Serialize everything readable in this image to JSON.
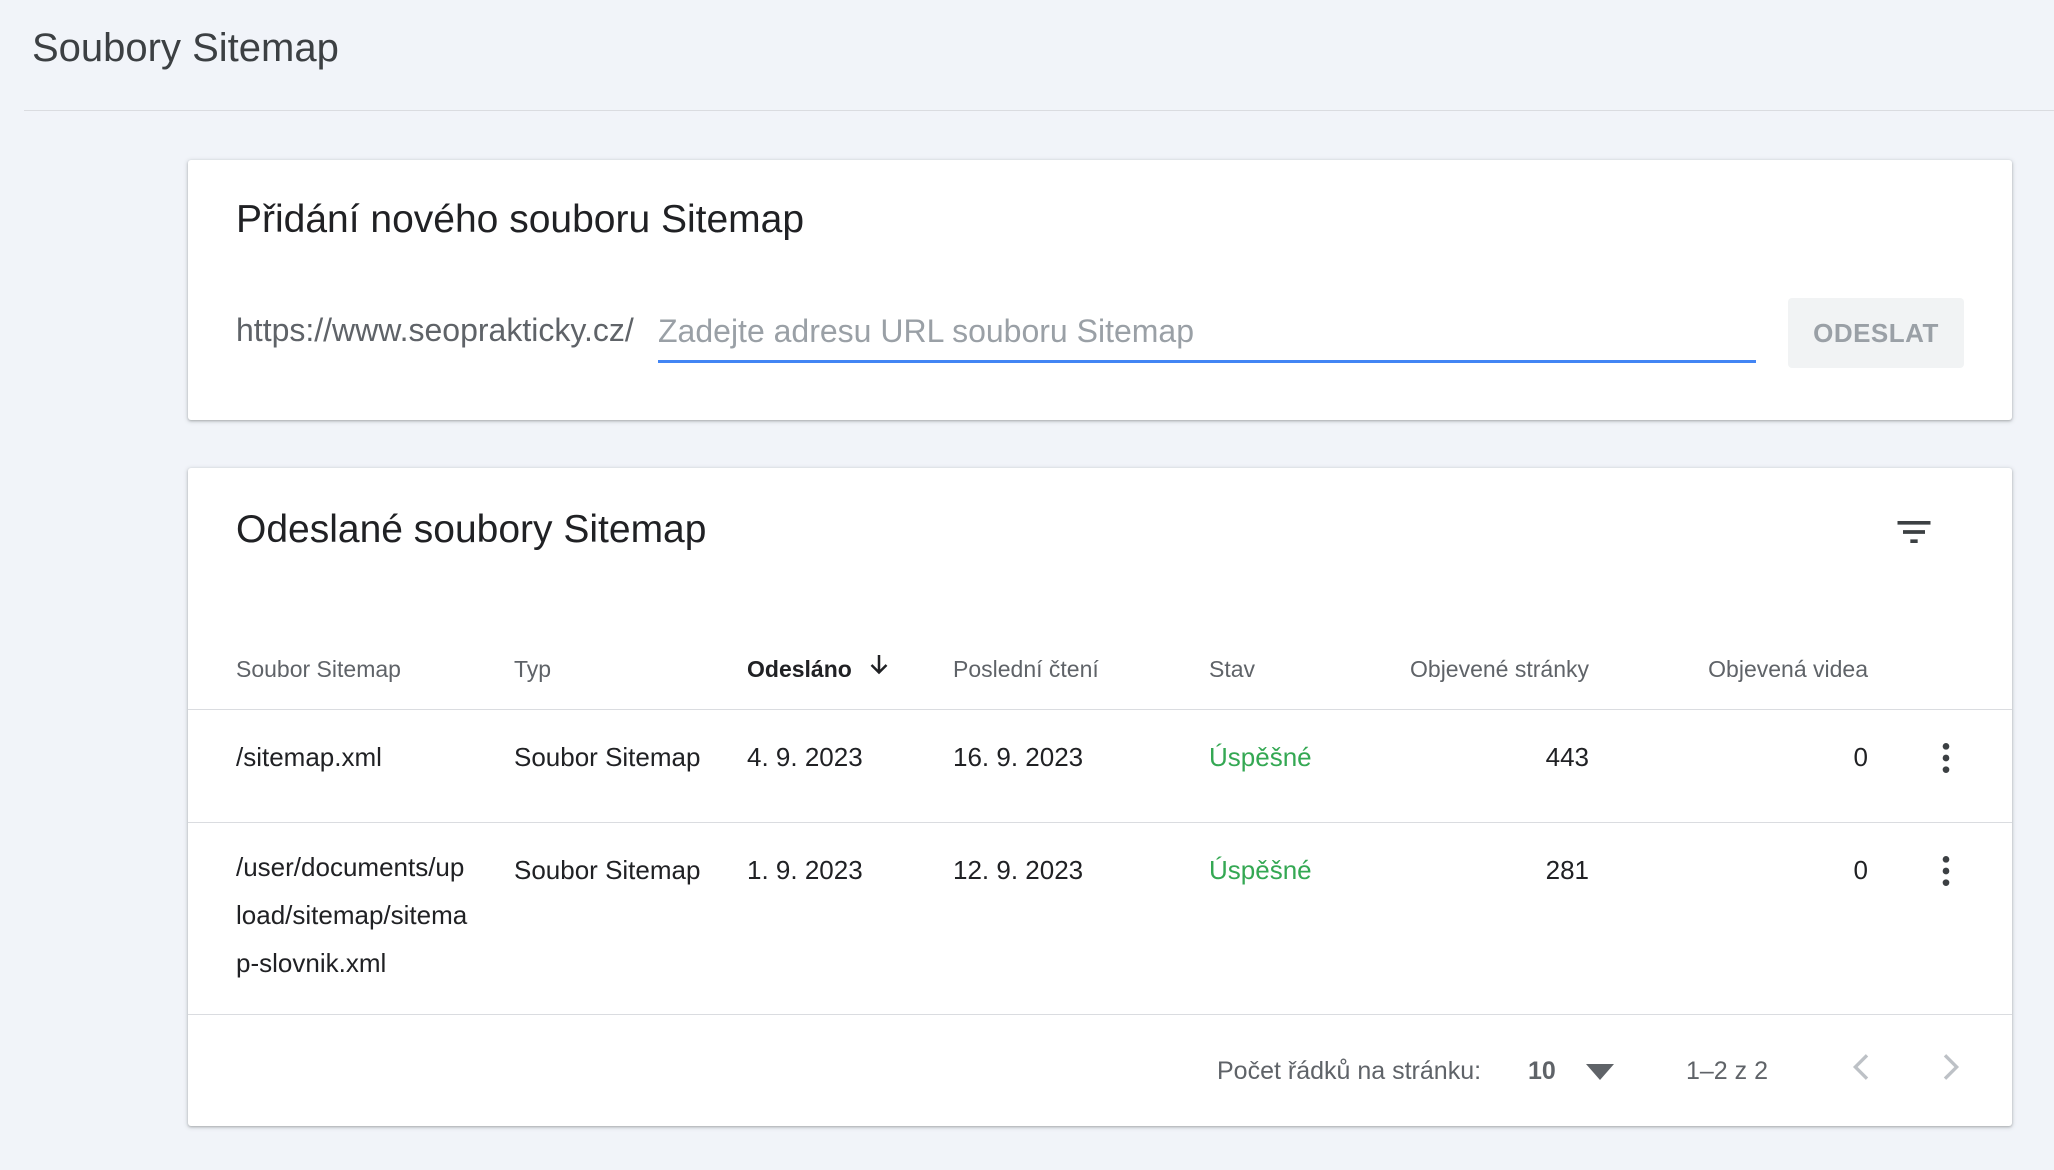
{
  "header": {
    "title": "Soubory Sitemap"
  },
  "add_card": {
    "title": "Přidání nového souboru Sitemap",
    "url_prefix": "https://www.seoprakticky.cz/",
    "input_value": "",
    "input_placeholder": "Zadejte adresu URL souboru Sitemap",
    "submit_label": "ODESLAT"
  },
  "list_card": {
    "title": "Odeslané soubory Sitemap",
    "filter_icon": "filter-list-icon",
    "columns": [
      "Soubor Sitemap",
      "Typ",
      "Odesláno",
      "Poslední čtení",
      "Stav",
      "Objevené stránky",
      "Objevená videa"
    ],
    "sorted_column": "Odesláno",
    "sort_direction": "descending",
    "rows": [
      {
        "file": "/sitemap.xml",
        "type": "Soubor Sitemap",
        "submitted": "4. 9. 2023",
        "last_read": "16. 9. 2023",
        "status": "Úspěšné",
        "pages": "443",
        "videos": "0"
      },
      {
        "file": "/user/documents/upload/sitemap/sitemap-slovnik.xml",
        "type": "Soubor Sitemap",
        "submitted": "1. 9. 2023",
        "last_read": "12. 9. 2023",
        "status": "Úspěšné",
        "pages": "281",
        "videos": "0"
      }
    ],
    "footer": {
      "rows_per_page_label": "Počet řádků na stránku:",
      "rows_per_page_value": "10",
      "range_text": "1–2 z 2"
    }
  },
  "colors": {
    "background": "#f1f4f9",
    "accent": "#4285f4",
    "success": "#34a853",
    "muted_text": "#5f6368"
  }
}
